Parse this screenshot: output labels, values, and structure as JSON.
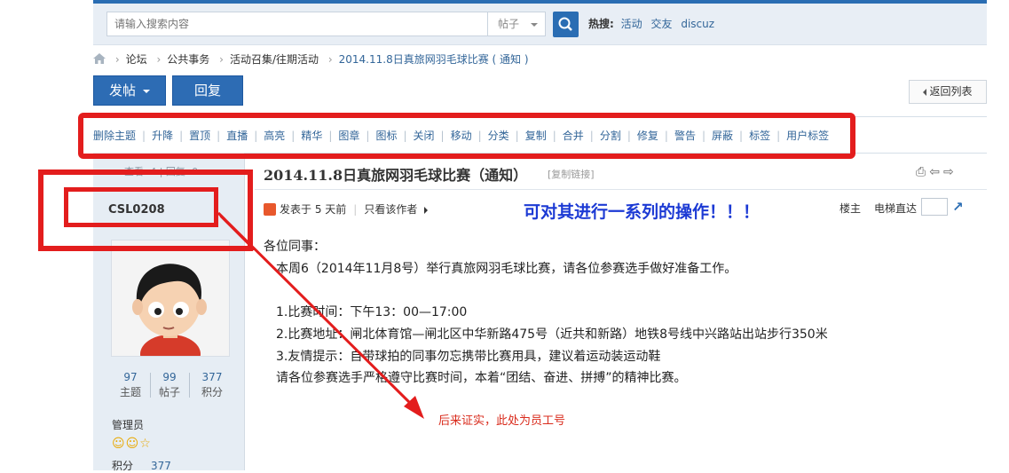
{
  "search": {
    "placeholder": "请输入搜索内容",
    "type_label": "帖子",
    "hot_label": "热搜:",
    "hot_links": [
      "活动",
      "交友",
      "discuz"
    ]
  },
  "breadcrumb": {
    "items": [
      "论坛",
      "公共事务",
      "活动召集/往期活动",
      "2014.11.8日真旅网羽毛球比赛 ( 通知 )"
    ]
  },
  "actions": {
    "post_label": "发帖",
    "reply_label": "回复",
    "back_label": "返回列表"
  },
  "moderation": {
    "items": [
      "删除主题",
      "升降",
      "置顶",
      "直播",
      "高亮",
      "精华",
      "图章",
      "图标",
      "关闭",
      "移动",
      "分类",
      "复制",
      "合并",
      "分割",
      "修复",
      "警告",
      "屏蔽",
      "标签",
      "用户标签"
    ]
  },
  "profile": {
    "counts_top": "查看: 4 | 回复: 0",
    "username": "CSL0208",
    "stats": [
      {
        "value": "97",
        "label": "主题"
      },
      {
        "value": "99",
        "label": "帖子"
      },
      {
        "value": "377",
        "label": "积分"
      }
    ],
    "role": "管理员",
    "badges": "☺☺☆",
    "score_label": "积分",
    "score_value": "377"
  },
  "post": {
    "title": "2014.11.8日真旅网羽毛球比赛（通知）",
    "copy_link": "[复制链接]",
    "posted": "发表于 5 天前",
    "only_author": "只看该作者",
    "louzhu": "楼主",
    "elevator": "电梯直达",
    "lines": [
      "各位同事：",
      "　本周6（2014年11月8号）举行真旅网羽毛球比赛，请各位参赛选手做好准备工作。",
      "",
      "　1.比赛时间：下午13：00—17:00",
      "　2.比赛地址：闸北体育馆—闸北区中华新路475号（近共和新路）地铁8号线中兴路站出站步行350米",
      "　3.友情提示：自带球拍的同事勿忘携带比赛用具，建议着运动装运动鞋",
      "　请各位参赛选手严格遵守比赛时间，本着“团结、奋进、拼搏”的精神比赛。"
    ]
  },
  "annotations": {
    "blue": "可对其进行一系列的操作！！！",
    "red": "后来证实，此处为员工号"
  },
  "colors": {
    "primary": "#2d6cb4",
    "link": "#336699",
    "annotation_red": "#e31d1d",
    "annotation_blue": "#1c3ad4"
  }
}
